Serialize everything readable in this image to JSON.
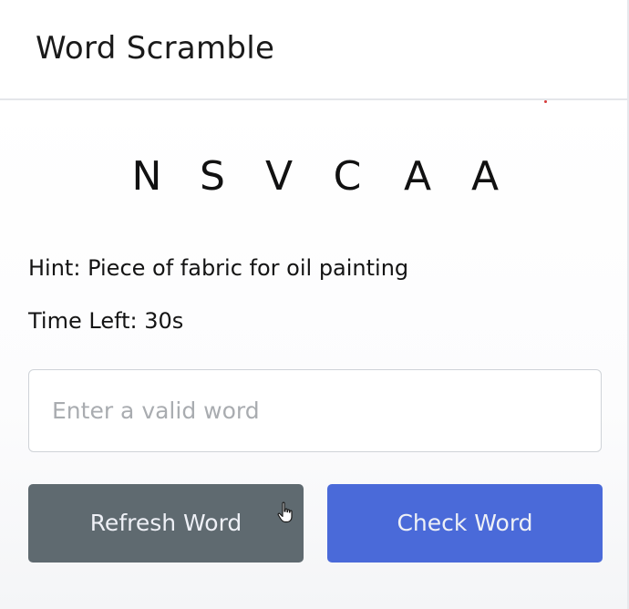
{
  "header": {
    "title": "Word Scramble"
  },
  "game": {
    "scrambled_letters": [
      "N",
      "S",
      "V",
      "C",
      "A",
      "A"
    ],
    "hint_label": "Hint:",
    "hint_text": "Piece of fabric for oil painting",
    "time_label": "Time Left:",
    "time_value": "30s"
  },
  "input": {
    "value": "",
    "placeholder": "Enter a valid word"
  },
  "buttons": {
    "refresh_label": "Refresh Word",
    "check_label": "Check Word"
  },
  "colors": {
    "refresh_bg": "#5f6a70",
    "check_bg": "#4a6ad9",
    "text_dark": "#141414"
  },
  "icons": {
    "cursor": "hand-pointer-icon"
  }
}
